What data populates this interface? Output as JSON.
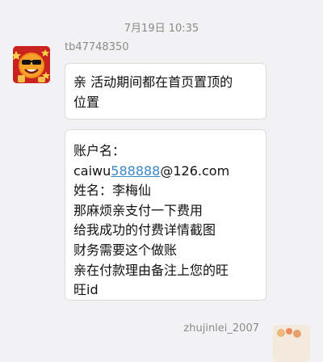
{
  "timestamp": "7月19日 10:35",
  "message1": {
    "sender": "tb47748350",
    "avatar_icon": "sunglasses-emoji-avatar-icon",
    "bubble1_lines": [
      "亲  活动期间都在首页置顶的",
      "位置"
    ],
    "bubble2": {
      "line1": "账户名：",
      "email_prefix": "caiwu",
      "email_link": "588888",
      "email_suffix": "@126.com",
      "lines": [
        "姓名：李梅仙",
        "那麻烦亲支付一下费用",
        "给我成功的付费详情截图",
        "财务需要这个做账",
        "亲在付款理由备注上您的旺",
        "旺id"
      ]
    }
  },
  "message2": {
    "sender": "zhujinlei_2007",
    "avatar_icon": "user-avatar-icon"
  },
  "colors": {
    "background": "#f2f2f4",
    "bubble": "#ffffff",
    "link": "#3b87c9",
    "meta_text": "#8a8a8a"
  }
}
